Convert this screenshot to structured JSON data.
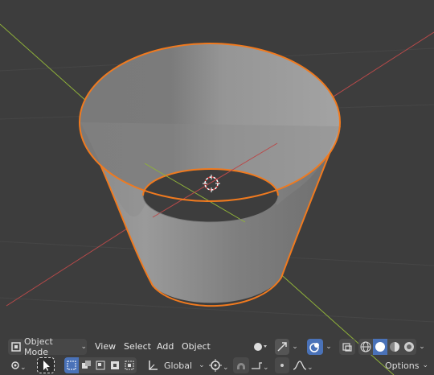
{
  "header": {
    "mode_label": "Object Mode",
    "menu": {
      "view": "View",
      "select": "Select",
      "add": "Add",
      "object": "Object"
    }
  },
  "toolbar": {
    "orientation_label": "Global",
    "options_label": "Options"
  },
  "colors": {
    "viewport_bg": "#3d3d3d",
    "outline": "#f07a1f",
    "x_axis": "#b94a4a",
    "y_axis": "#8fb13a",
    "active_blue": "#4a72b8"
  },
  "icons": [
    "editor-type-icon",
    "view-orbit-icon",
    "gizmo-toggle-icon",
    "overlay-toggle-icon",
    "xray-toggle-icon",
    "wireframe-shading-icon",
    "solid-shading-icon",
    "material-shading-icon",
    "rendered-shading-icon",
    "transform-pivot-icon",
    "select-box-icon",
    "orientation-icon",
    "snap-icon",
    "proportional-edit-icon",
    "3d-cursor-icon"
  ]
}
